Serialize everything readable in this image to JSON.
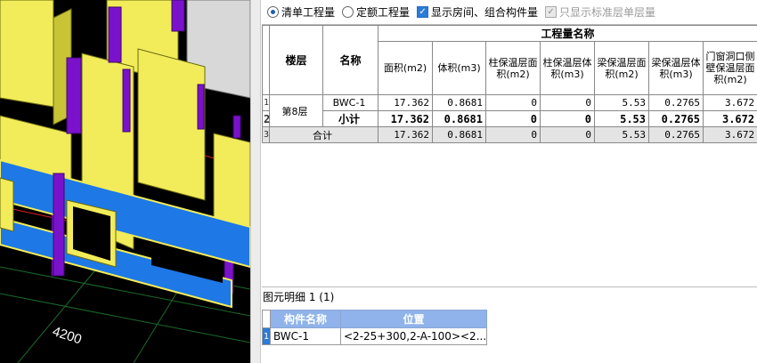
{
  "options": {
    "radio_bill": "清单工程量",
    "radio_quota": "定额工程量",
    "check_show_rooms": "显示房间、组合构件量",
    "check_standard_floor": "只显示标准层单层量"
  },
  "viewport": {
    "dimension_label": "4200"
  },
  "qty_table": {
    "col_floor": "楼层",
    "col_name": "名称",
    "group_header": "工程量名称",
    "columns": [
      "面积(m2)",
      "体积(m3)",
      "柱保温层面积(m2)",
      "柱保温层体积(m3)",
      "梁保温层面积(m2)",
      "梁保温层体积(m3)",
      "门窗洞口侧壁保温层面积(m2)"
    ],
    "row_numbers": [
      "1",
      "2",
      "3"
    ],
    "floor": "第8层",
    "rows": [
      {
        "name": "BWC-1",
        "values": [
          "17.362",
          "0.8681",
          "0",
          "0",
          "5.53",
          "0.2765",
          "3.672"
        ]
      },
      {
        "name": "小计",
        "values": [
          "17.362",
          "0.8681",
          "0",
          "0",
          "5.53",
          "0.2765",
          "3.672"
        ]
      }
    ],
    "total": {
      "label": "合计",
      "values": [
        "17.362",
        "0.8681",
        "0",
        "0",
        "5.53",
        "0.2765",
        "3.672"
      ]
    }
  },
  "detail": {
    "title": "图元明细 1 (1)",
    "col_component": "构件名称",
    "col_position": "位置",
    "rows": [
      {
        "num": "1",
        "component": "BWC-1",
        "position": "<2-25+300,2-A-100><2..."
      }
    ]
  },
  "colors": {
    "wall_yellow": "#f2ec5a",
    "column_purple": "#7a12cc",
    "beam_blue": "#1e78e6",
    "header_blue": "#8fb3ea"
  }
}
